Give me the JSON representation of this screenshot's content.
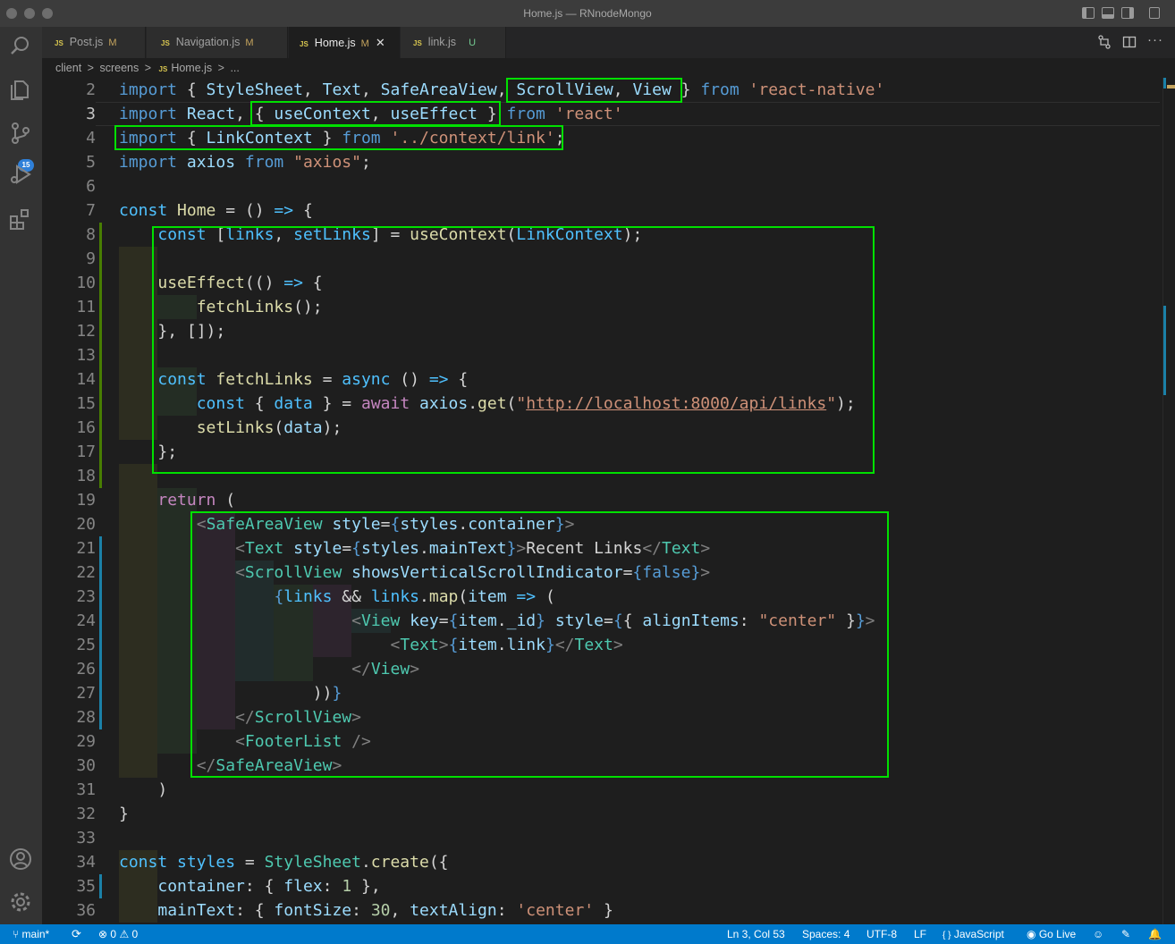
{
  "window": {
    "title": "Home.js — RNnodeMongo"
  },
  "tabs": [
    {
      "label": "Post.js",
      "status": "M"
    },
    {
      "label": "Navigation.js",
      "status": "M"
    },
    {
      "label": "Home.js",
      "status": "M"
    },
    {
      "label": "link.js",
      "status": "U"
    }
  ],
  "file_icon": "JS",
  "breadcrumb": {
    "p1": "client",
    "p2": "screens",
    "p3": "Home.js",
    "p4": "...",
    "sep": ">"
  },
  "source_control": {
    "badge": "15"
  },
  "code": [
    {
      "n": "2",
      "t": [
        [
          "k",
          "import"
        ],
        [
          "p",
          " { "
        ],
        [
          "v",
          "StyleSheet"
        ],
        [
          "p",
          ", "
        ],
        [
          "v",
          "Text"
        ],
        [
          "p",
          ", "
        ],
        [
          "v",
          "SafeAreaView"
        ],
        [
          "p",
          ", "
        ],
        [
          "v",
          "ScrollView"
        ],
        [
          "p",
          ", "
        ],
        [
          "v",
          "View"
        ],
        [
          "p",
          " } "
        ],
        [
          "k",
          "from"
        ],
        [
          "p",
          " "
        ],
        [
          "s",
          "'react-native'"
        ]
      ]
    },
    {
      "n": "3",
      "t": [
        [
          "k",
          "import"
        ],
        [
          "p",
          " "
        ],
        [
          "v",
          "React"
        ],
        [
          "p",
          ", { "
        ],
        [
          "v",
          "useContext"
        ],
        [
          "p",
          ", "
        ],
        [
          "v",
          "useEffect"
        ],
        [
          "p",
          " } "
        ],
        [
          "k",
          "from"
        ],
        [
          "p",
          " "
        ],
        [
          "s",
          "'react'"
        ]
      ]
    },
    {
      "n": "4",
      "t": [
        [
          "k",
          "import"
        ],
        [
          "p",
          " { "
        ],
        [
          "v",
          "LinkContext"
        ],
        [
          "p",
          " } "
        ],
        [
          "k",
          "from"
        ],
        [
          "p",
          " "
        ],
        [
          "s",
          "'../context/link'"
        ],
        [
          "p",
          ";"
        ]
      ]
    },
    {
      "n": "5",
      "t": [
        [
          "k",
          "import"
        ],
        [
          "p",
          " "
        ],
        [
          "v",
          "axios"
        ],
        [
          "p",
          " "
        ],
        [
          "k",
          "from"
        ],
        [
          "p",
          " "
        ],
        [
          "s",
          "\"axios\""
        ],
        [
          "p",
          ";"
        ]
      ]
    },
    {
      "n": "6",
      "t": []
    },
    {
      "n": "7",
      "t": [
        [
          "c",
          "const"
        ],
        [
          "p",
          " "
        ],
        [
          "f",
          "Home"
        ],
        [
          "p",
          " = () "
        ],
        [
          "c",
          "=>"
        ],
        [
          "p",
          " {"
        ]
      ]
    },
    {
      "n": "8",
      "t": [
        [
          "c",
          "const"
        ],
        [
          "p",
          " ["
        ],
        [
          "c",
          "links"
        ],
        [
          "p",
          ", "
        ],
        [
          "c",
          "setLinks"
        ],
        [
          "p",
          "] = "
        ],
        [
          "f",
          "useContext"
        ],
        [
          "p",
          "("
        ],
        [
          "c",
          "LinkContext"
        ],
        [
          "p",
          ");"
        ]
      ]
    },
    {
      "n": "9",
      "t": []
    },
    {
      "n": "10",
      "t": [
        [
          "f",
          "useEffect"
        ],
        [
          "p",
          "(() "
        ],
        [
          "c",
          "=>"
        ],
        [
          "p",
          " {"
        ]
      ]
    },
    {
      "n": "11",
      "t": [
        [
          "f",
          "fetchLinks"
        ],
        [
          "p",
          "();"
        ]
      ]
    },
    {
      "n": "12",
      "t": [
        [
          "p",
          "}, []);"
        ]
      ]
    },
    {
      "n": "13",
      "t": []
    },
    {
      "n": "14",
      "t": [
        [
          "c",
          "const"
        ],
        [
          "p",
          " "
        ],
        [
          "f",
          "fetchLinks"
        ],
        [
          "p",
          " = "
        ],
        [
          "c",
          "async"
        ],
        [
          "p",
          " () "
        ],
        [
          "c",
          "=>"
        ],
        [
          "p",
          " {"
        ]
      ]
    },
    {
      "n": "15",
      "t": [
        [
          "c",
          "const"
        ],
        [
          "p",
          " { "
        ],
        [
          "c",
          "data"
        ],
        [
          "p",
          " } = "
        ],
        [
          "kw",
          "await"
        ],
        [
          "p",
          " "
        ],
        [
          "v",
          "axios"
        ],
        [
          "p",
          "."
        ],
        [
          "f",
          "get"
        ],
        [
          "p",
          "("
        ],
        [
          "s",
          "\""
        ],
        [
          "su",
          "http://localhost:8000/api/links"
        ],
        [
          "s",
          "\""
        ],
        [
          "p",
          ");"
        ]
      ]
    },
    {
      "n": "16",
      "t": [
        [
          "f",
          "setLinks"
        ],
        [
          "p",
          "("
        ],
        [
          "v",
          "data"
        ],
        [
          "p",
          ");"
        ]
      ]
    },
    {
      "n": "17",
      "t": [
        [
          "p",
          "};"
        ]
      ]
    },
    {
      "n": "18",
      "t": []
    },
    {
      "n": "19",
      "t": [
        [
          "kw",
          "return"
        ],
        [
          "p",
          " ("
        ]
      ]
    },
    {
      "n": "20",
      "t": [
        [
          "g",
          "<"
        ],
        [
          "t",
          "SafeAreaView"
        ],
        [
          "p",
          " "
        ],
        [
          "v",
          "style"
        ],
        [
          "p",
          "="
        ],
        [
          "k",
          "{"
        ],
        [
          "v",
          "styles"
        ],
        [
          "p",
          "."
        ],
        [
          "v",
          "container"
        ],
        [
          "k",
          "}"
        ],
        [
          "g",
          ">"
        ]
      ]
    },
    {
      "n": "21",
      "t": [
        [
          "g",
          "<"
        ],
        [
          "t",
          "Text"
        ],
        [
          "p",
          " "
        ],
        [
          "v",
          "style"
        ],
        [
          "p",
          "="
        ],
        [
          "k",
          "{"
        ],
        [
          "v",
          "styles"
        ],
        [
          "p",
          "."
        ],
        [
          "v",
          "mainText"
        ],
        [
          "k",
          "}"
        ],
        [
          "g",
          ">"
        ],
        [
          "p",
          "Recent Links"
        ],
        [
          "g",
          "</"
        ],
        [
          "t",
          "Text"
        ],
        [
          "g",
          ">"
        ]
      ]
    },
    {
      "n": "22",
      "t": [
        [
          "g",
          "<"
        ],
        [
          "t",
          "ScrollView"
        ],
        [
          "p",
          " "
        ],
        [
          "v",
          "showsVerticalScrollIndicator"
        ],
        [
          "p",
          "="
        ],
        [
          "k",
          "{"
        ],
        [
          "k",
          "false"
        ],
        [
          "k",
          "}"
        ],
        [
          "g",
          ">"
        ]
      ]
    },
    {
      "n": "23",
      "t": [
        [
          "k",
          "{"
        ],
        [
          "c",
          "links"
        ],
        [
          "p",
          " && "
        ],
        [
          "c",
          "links"
        ],
        [
          "p",
          "."
        ],
        [
          "f",
          "map"
        ],
        [
          "p",
          "("
        ],
        [
          "v",
          "item"
        ],
        [
          "p",
          " "
        ],
        [
          "c",
          "=>"
        ],
        [
          "p",
          " ("
        ]
      ]
    },
    {
      "n": "24",
      "t": [
        [
          "g",
          "<"
        ],
        [
          "t",
          "View"
        ],
        [
          "p",
          " "
        ],
        [
          "v",
          "key"
        ],
        [
          "p",
          "="
        ],
        [
          "k",
          "{"
        ],
        [
          "v",
          "item"
        ],
        [
          "p",
          "."
        ],
        [
          "v",
          "_id"
        ],
        [
          "k",
          "}"
        ],
        [
          "p",
          " "
        ],
        [
          "v",
          "style"
        ],
        [
          "p",
          "="
        ],
        [
          "k",
          "{"
        ],
        [
          "p",
          "{ "
        ],
        [
          "v",
          "alignItems"
        ],
        [
          "p",
          ": "
        ],
        [
          "s",
          "\"center\""
        ],
        [
          "p",
          " }"
        ],
        [
          "k",
          "}"
        ],
        [
          "g",
          ">"
        ]
      ]
    },
    {
      "n": "25",
      "t": [
        [
          "g",
          "<"
        ],
        [
          "t",
          "Text"
        ],
        [
          "g",
          ">"
        ],
        [
          "k",
          "{"
        ],
        [
          "v",
          "item"
        ],
        [
          "p",
          "."
        ],
        [
          "v",
          "link"
        ],
        [
          "k",
          "}"
        ],
        [
          "g",
          "</"
        ],
        [
          "t",
          "Text"
        ],
        [
          "g",
          ">"
        ]
      ]
    },
    {
      "n": "26",
      "t": [
        [
          "g",
          "</"
        ],
        [
          "t",
          "View"
        ],
        [
          "g",
          ">"
        ]
      ]
    },
    {
      "n": "27",
      "t": [
        [
          "p",
          "))"
        ],
        [
          "k",
          "}"
        ]
      ]
    },
    {
      "n": "28",
      "t": [
        [
          "g",
          "</"
        ],
        [
          "t",
          "ScrollView"
        ],
        [
          "g",
          ">"
        ]
      ]
    },
    {
      "n": "29",
      "t": [
        [
          "g",
          "<"
        ],
        [
          "t",
          "FooterList"
        ],
        [
          "p",
          " "
        ],
        [
          "g",
          "/>"
        ]
      ]
    },
    {
      "n": "30",
      "t": [
        [
          "g",
          "</"
        ],
        [
          "t",
          "SafeAreaView"
        ],
        [
          "g",
          ">"
        ]
      ]
    },
    {
      "n": "31",
      "t": [
        [
          "p",
          ")"
        ]
      ]
    },
    {
      "n": "32",
      "t": [
        [
          "p",
          "}"
        ]
      ]
    },
    {
      "n": "33",
      "t": []
    },
    {
      "n": "34",
      "t": [
        [
          "c",
          "const"
        ],
        [
          "p",
          " "
        ],
        [
          "c",
          "styles"
        ],
        [
          "p",
          " = "
        ],
        [
          "t",
          "StyleSheet"
        ],
        [
          "p",
          "."
        ],
        [
          "f",
          "create"
        ],
        [
          "p",
          "({"
        ]
      ]
    },
    {
      "n": "35",
      "t": [
        [
          "v",
          "container"
        ],
        [
          "p",
          ": { "
        ],
        [
          "v",
          "flex"
        ],
        [
          "p",
          ": "
        ],
        [
          "n",
          "1"
        ],
        [
          "p",
          " },"
        ]
      ]
    },
    {
      "n": "36",
      "t": [
        [
          "v",
          "mainText"
        ],
        [
          "p",
          ": { "
        ],
        [
          "v",
          "fontSize"
        ],
        [
          "p",
          ": "
        ],
        [
          "n",
          "30"
        ],
        [
          "p",
          ", "
        ],
        [
          "v",
          "textAlign"
        ],
        [
          "p",
          ": "
        ],
        [
          "s",
          "'center'"
        ],
        [
          "p",
          " }"
        ]
      ]
    }
  ],
  "status": {
    "branch": "main*",
    "errors": "0",
    "warnings": "0",
    "position": "Ln 3, Col 53",
    "spaces": "Spaces: 4",
    "encoding": "UTF-8",
    "eol": "LF",
    "language": "JavaScript",
    "golive": "Go Live",
    "language_icon": "{ }"
  },
  "icons": {
    "explorer": "files-icon",
    "search": "search-icon",
    "scm": "source-control-icon",
    "debug": "run-debug-icon",
    "extensions": "extensions-icon",
    "account": "account-icon",
    "settings": "gear-icon"
  }
}
